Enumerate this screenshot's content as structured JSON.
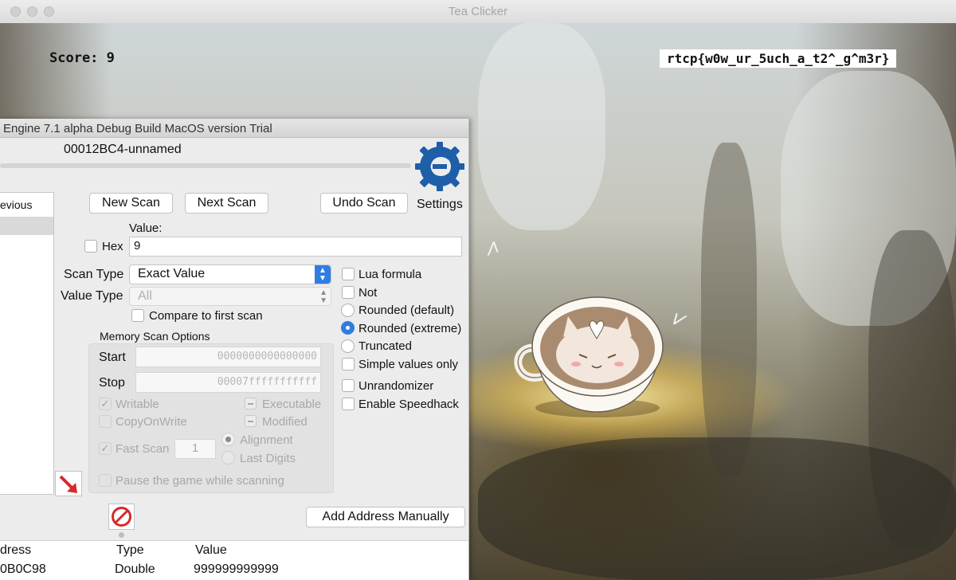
{
  "window": {
    "title": "Tea Clicker"
  },
  "game": {
    "score_text": "Score: 9",
    "flag_text": "rtcp{w0w_ur_5uch_a_t2^_g^m3r}"
  },
  "cheat_engine": {
    "title": "Engine 7.1 alpha Debug Build MacOS version Trial",
    "process": "00012BC4-unnamed",
    "settings_label": "Settings",
    "found_list_header": "evious",
    "buttons": {
      "new_scan": "New Scan",
      "next_scan": "Next Scan",
      "undo_scan": "Undo Scan",
      "add_address": "Add Address Manually"
    },
    "value_label": "Value:",
    "hex_label": "Hex",
    "value": "9",
    "scan_type_label": "Scan Type",
    "scan_type": "Exact Value",
    "value_type_label": "Value Type",
    "value_type": "All",
    "compare_first": "Compare to first scan",
    "options": {
      "lua_formula": "Lua formula",
      "not": "Not",
      "rounded_default": "Rounded (default)",
      "rounded_extreme": "Rounded (extreme)",
      "truncated": "Truncated",
      "simple_values": "Simple values only",
      "unrandomizer": "Unrandomizer",
      "speedhack": "Enable Speedhack"
    },
    "memory_scan": {
      "title": "Memory Scan Options",
      "start_label": "Start",
      "start_value": "0000000000000000",
      "stop_label": "Stop",
      "stop_value": "00007fffffffffff",
      "writable": "Writable",
      "executable": "Executable",
      "copy_on_write": "CopyOnWrite",
      "modified": "Modified",
      "fast_scan": "Fast Scan",
      "fast_scan_value": "1",
      "alignment": "Alignment",
      "last_digits": "Last Digits",
      "pause_game": "Pause the game while scanning"
    },
    "table": {
      "headers": [
        "dress",
        "Type",
        "Value"
      ],
      "rows": [
        {
          "address": "0B0C98",
          "type": "Double",
          "value": "999999999999"
        }
      ]
    },
    "colors": {
      "accent": "#2f7de1",
      "logo": "#1f5ea8",
      "stop_icon": "#d52a2a"
    }
  }
}
